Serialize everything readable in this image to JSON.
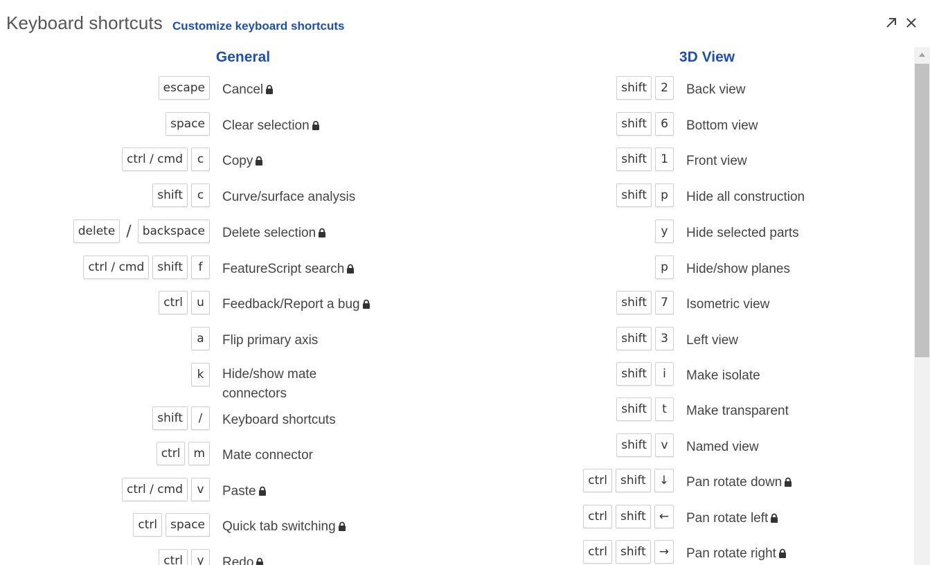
{
  "header": {
    "title": "Keyboard shortcuts",
    "customize_link": "Customize keyboard shortcuts",
    "expand_icon": "expand-arrow-icon",
    "close_icon": "close-icon"
  },
  "general": {
    "heading": "General",
    "rows": [
      {
        "keys": [
          "escape"
        ],
        "label": "Cancel",
        "locked": true
      },
      {
        "keys": [
          "space"
        ],
        "label": "Clear selection",
        "locked": true
      },
      {
        "keys": [
          "ctrl / cmd",
          "c"
        ],
        "label": "Copy",
        "locked": true
      },
      {
        "keys": [
          "shift",
          "c"
        ],
        "label": "Curve/surface analysis",
        "locked": false
      },
      {
        "keys": [
          "delete",
          "/",
          "backspace"
        ],
        "label": "Delete selection",
        "locked": true
      },
      {
        "keys": [
          "ctrl / cmd",
          "shift",
          "f"
        ],
        "label": "FeatureScript search",
        "locked": true
      },
      {
        "keys": [
          "ctrl",
          "u"
        ],
        "label": "Feedback/Report a bug",
        "locked": true
      },
      {
        "keys": [
          "a"
        ],
        "label": "Flip primary axis",
        "locked": false
      },
      {
        "keys": [
          "k"
        ],
        "label": "Hide/show mate connectors",
        "locked": false
      },
      {
        "keys": [
          "shift",
          "/"
        ],
        "label": "Keyboard shortcuts",
        "locked": false
      },
      {
        "keys": [
          "ctrl",
          "m"
        ],
        "label": "Mate connector",
        "locked": false
      },
      {
        "keys": [
          "ctrl / cmd",
          "v"
        ],
        "label": "Paste",
        "locked": true
      },
      {
        "keys": [
          "ctrl",
          "space"
        ],
        "label": "Quick tab switching",
        "locked": true
      },
      {
        "keys": [
          "ctrl",
          "y"
        ],
        "label": "Redo",
        "locked": true
      }
    ]
  },
  "view3d": {
    "heading": "3D View",
    "rows": [
      {
        "keys": [
          "shift",
          "2"
        ],
        "label": "Back view",
        "locked": false
      },
      {
        "keys": [
          "shift",
          "6"
        ],
        "label": "Bottom view",
        "locked": false
      },
      {
        "keys": [
          "shift",
          "1"
        ],
        "label": "Front view",
        "locked": false
      },
      {
        "keys": [
          "shift",
          "p"
        ],
        "label": "Hide all construction",
        "locked": false
      },
      {
        "keys": [
          "y"
        ],
        "label": "Hide selected parts",
        "locked": false
      },
      {
        "keys": [
          "p"
        ],
        "label": "Hide/show planes",
        "locked": false
      },
      {
        "keys": [
          "shift",
          "7"
        ],
        "label": "Isometric view",
        "locked": false
      },
      {
        "keys": [
          "shift",
          "3"
        ],
        "label": "Left view",
        "locked": false
      },
      {
        "keys": [
          "shift",
          "i"
        ],
        "label": "Make isolate",
        "locked": false
      },
      {
        "keys": [
          "shift",
          "t"
        ],
        "label": "Make transparent",
        "locked": false
      },
      {
        "keys": [
          "shift",
          "v"
        ],
        "label": "Named view",
        "locked": false
      },
      {
        "keys": [
          "ctrl",
          "shift",
          "↓"
        ],
        "label": "Pan rotate down",
        "locked": true
      },
      {
        "keys": [
          "ctrl",
          "shift",
          "←"
        ],
        "label": "Pan rotate left",
        "locked": true
      },
      {
        "keys": [
          "ctrl",
          "shift",
          "→"
        ],
        "label": "Pan rotate right",
        "locked": true
      }
    ]
  },
  "colors": {
    "accent": "#1d4fb0",
    "text": "#444444",
    "key_border": "#cfcfcf"
  }
}
